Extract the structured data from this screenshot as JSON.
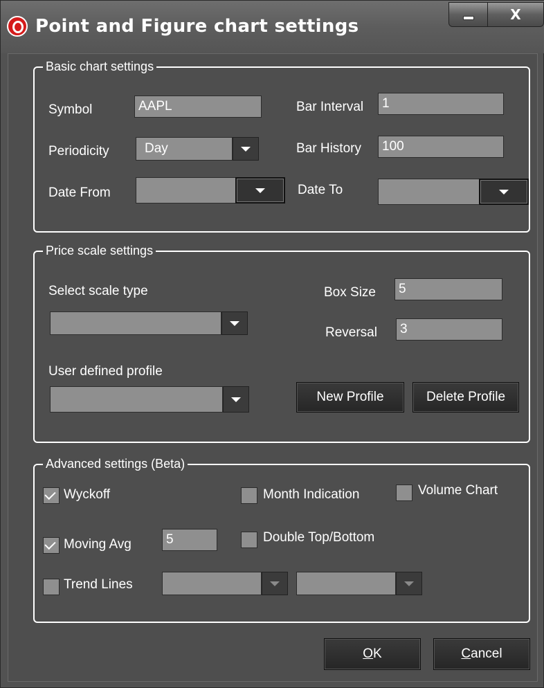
{
  "window": {
    "title": "Point and Figure chart settings",
    "close_glyph": "X"
  },
  "basic": {
    "legend": "Basic chart settings",
    "symbol_label": "Symbol",
    "symbol_value": "AAPL",
    "bar_interval_label": "Bar Interval",
    "bar_interval_value": "1",
    "periodicity_label": "Periodicity",
    "periodicity_value": "Day",
    "bar_history_label": "Bar History",
    "bar_history_value": "100",
    "date_from_label": "Date From",
    "date_from_value": "",
    "date_to_label": "Date To",
    "date_to_value": ""
  },
  "price": {
    "legend": "Price scale settings",
    "scale_type_label": "Select scale type",
    "scale_type_value": "",
    "box_size_label": "Box Size",
    "box_size_value": "5",
    "reversal_label": "Reversal",
    "reversal_value": "3",
    "profile_label": "User defined profile",
    "profile_value": "",
    "new_profile_button": "New Profile",
    "delete_profile_button": "Delete Profile"
  },
  "advanced": {
    "legend": "Advanced settings (Beta)",
    "wyckoff_label": "Wyckoff",
    "wyckoff_checked": true,
    "month_indication_label": "Month Indication",
    "month_indication_checked": false,
    "volume_chart_label": "Volume Chart",
    "volume_chart_checked": false,
    "moving_avg_label": "Moving Avg",
    "moving_avg_checked": true,
    "moving_avg_value": "5",
    "double_top_label": "Double Top/Bottom",
    "double_top_checked": false,
    "trend_lines_label": "Trend Lines",
    "trend_lines_checked": false,
    "trend_combo1_value": "",
    "trend_combo2_value": ""
  },
  "footer": {
    "ok_mnemonic": "O",
    "ok_rest": "K",
    "cancel_mnemonic": "C",
    "cancel_rest": "ancel"
  },
  "colors": {
    "app_icon": "#d51b1b",
    "field_bg": "#8f8f8f",
    "panel_bg": "#4e4e4e"
  }
}
